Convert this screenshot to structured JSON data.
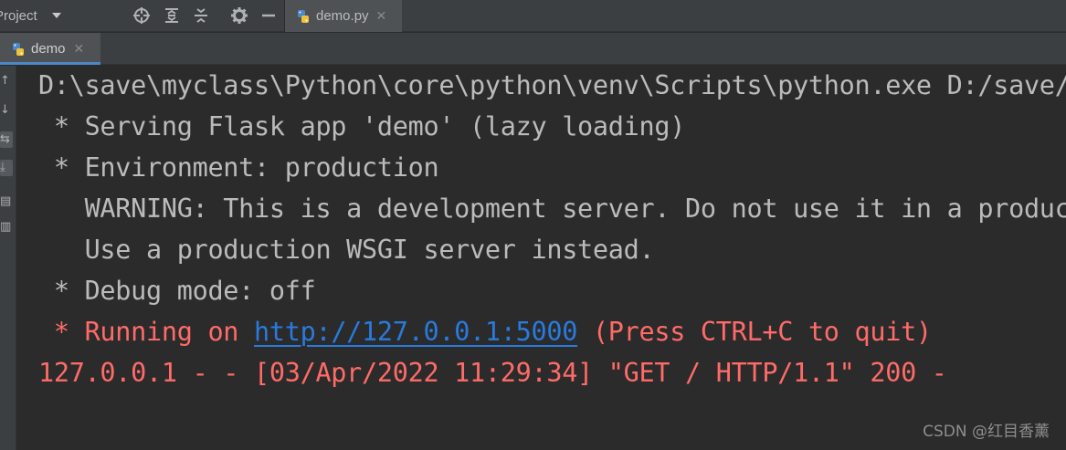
{
  "toolbar": {
    "project_label": "Project",
    "file_tab_label": "demo.py",
    "icons": [
      "crosshair-icon",
      "expand-all-icon",
      "collapse-all-icon",
      "gear-icon",
      "minimize-icon"
    ]
  },
  "run_tab": {
    "label": "demo"
  },
  "gutter_icons": [
    "arrow-up-icon",
    "arrow-down-icon",
    "soft-wrap-icon",
    "scroll-to-end-icon",
    "print-icon",
    "trash-icon"
  ],
  "console": {
    "lines": [
      {
        "text": "D:\\save\\myclass\\Python\\core\\python\\venv\\Scripts\\python.exe D:/save/"
      },
      {
        "text": " * Serving Flask app 'demo' (lazy loading)"
      },
      {
        "text": " * Environment: production"
      },
      {
        "text": "   WARNING: This is a development server. Do not use it in a production deployment."
      },
      {
        "text": "   Use a production WSGI server instead."
      },
      {
        "text": " * Debug mode: off"
      },
      {
        "prefix": " * Running on ",
        "link": "http://127.0.0.1:5000",
        "suffix": " (Press CTRL+C to quit)"
      },
      {
        "text": "127.0.0.1 - - [03/Apr/2022 11:29:34] \"GET / HTTP/1.1\" 200 -"
      }
    ]
  },
  "colors": {
    "background": "#2b2b2b",
    "stdout": "#bbbbbb",
    "stderr": "#ff6b68",
    "link": "#287bde",
    "tab_underline": "#4a88c7"
  },
  "watermark": "CSDN @红目香薰"
}
